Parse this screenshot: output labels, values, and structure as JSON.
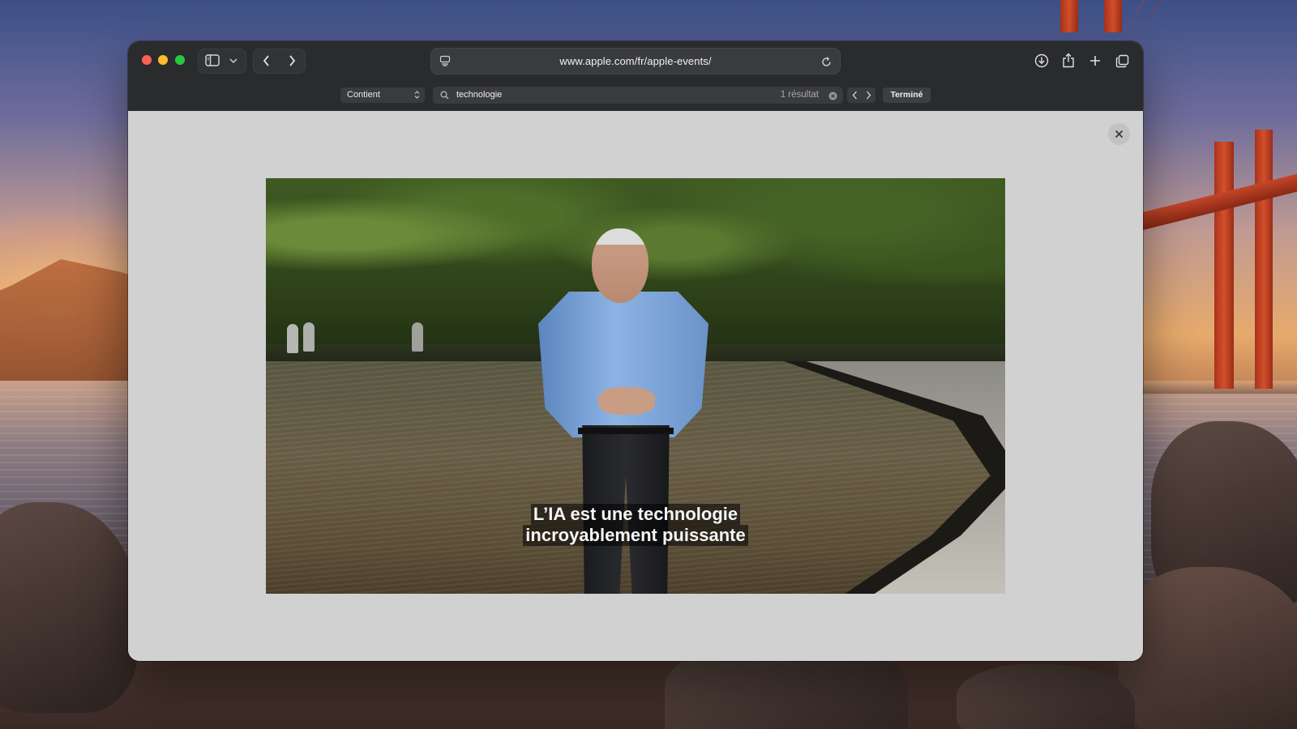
{
  "browser": {
    "url": "www.apple.com/fr/apple-events/",
    "find_bar": {
      "match_mode": "Contient",
      "query": "technologie",
      "result_count": "1 résultat",
      "done_label": "Terminé"
    }
  },
  "video": {
    "subtitle_line1": "L’IA est une technologie",
    "subtitle_line2": "incroyablement puissante"
  },
  "colors": {
    "close": "#ff5f57",
    "minimize": "#febc2e",
    "maximize": "#28c840",
    "toolbar": "#2a2b2d",
    "page_background": "#d1d1d1"
  },
  "icons": {
    "toolbar": [
      "sidebar-icon",
      "chevron-down-icon",
      "back-icon",
      "forward-icon",
      "page-menu-icon",
      "reload-icon",
      "download-icon",
      "share-icon",
      "new-tab-icon",
      "tab-overview-icon"
    ],
    "find_bar": [
      "search-icon",
      "clear-icon",
      "previous-result-icon",
      "next-result-icon"
    ],
    "content": [
      "close-icon"
    ]
  }
}
